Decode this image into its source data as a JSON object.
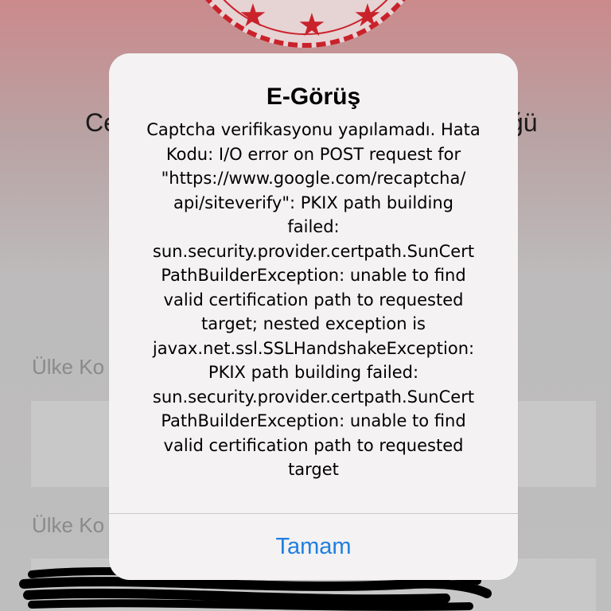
{
  "background": {
    "title_left": "Ce",
    "title_right": "ğü",
    "labels": [
      "Ülke Ko",
      "Ülke Ko"
    ],
    "emblem_color": "#c9222b"
  },
  "alert": {
    "title": "E-Görüş",
    "message": "Captcha verifikasyonu yapılamadı. Hata\nKodu: I/O error on POST request for\n\"https://www.google.com/recaptcha/\napi/siteverify\": PKIX path building\nfailed:\nsun.security.provider.certpath.SunCert\nPathBuilderException: unable to find\nvalid certification path to requested\ntarget; nested exception is\njavax.net.ssl.SSLHandshakeException:\nPKIX path building failed:\nsun.security.provider.certpath.SunCert\nPathBuilderException: unable to find\nvalid certification path to requested\ntarget",
    "button_label": "Tamam",
    "button_color": "#1f7fe0"
  }
}
